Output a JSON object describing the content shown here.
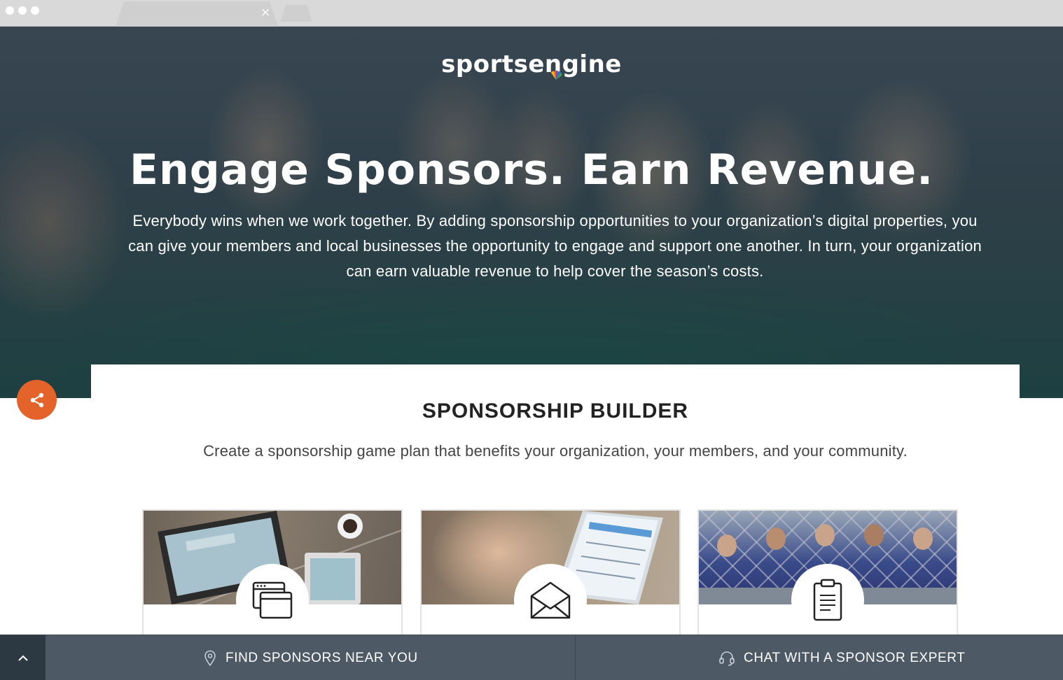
{
  "browser": {
    "tab_close": "×"
  },
  "hero": {
    "logo_text": "sportsengine",
    "title": "Engage Sponsors. Earn Revenue.",
    "paragraph": "Everybody wins when we work together. By adding sponsorship opportunities to your organization’s digital properties, you can give your members and local businesses the opportunity to engage and support one another. In turn, your organization can earn valuable revenue to help cover the season’s costs."
  },
  "sponsorship_builder": {
    "title": "SPONSORSHIP BUILDER",
    "subtitle": "Create a sponsorship game plan that benefits your organization, your members, and your community.",
    "cards": [
      {
        "image": "laptop-desk-photo",
        "icon": "browser-windows-icon"
      },
      {
        "image": "phone-email-photo",
        "icon": "envelope-icon"
      },
      {
        "image": "baseball-dugout-photo",
        "icon": "clipboard-icon"
      }
    ]
  },
  "bottom_bar": {
    "find_label": "FIND SPONSORS NEAR YOU",
    "chat_label": "CHAT WITH A SPONSOR EXPERT"
  },
  "colors": {
    "accent_orange": "#e3632b",
    "bottom_bar": "#4d5a66",
    "up_button": "#2d3942"
  }
}
